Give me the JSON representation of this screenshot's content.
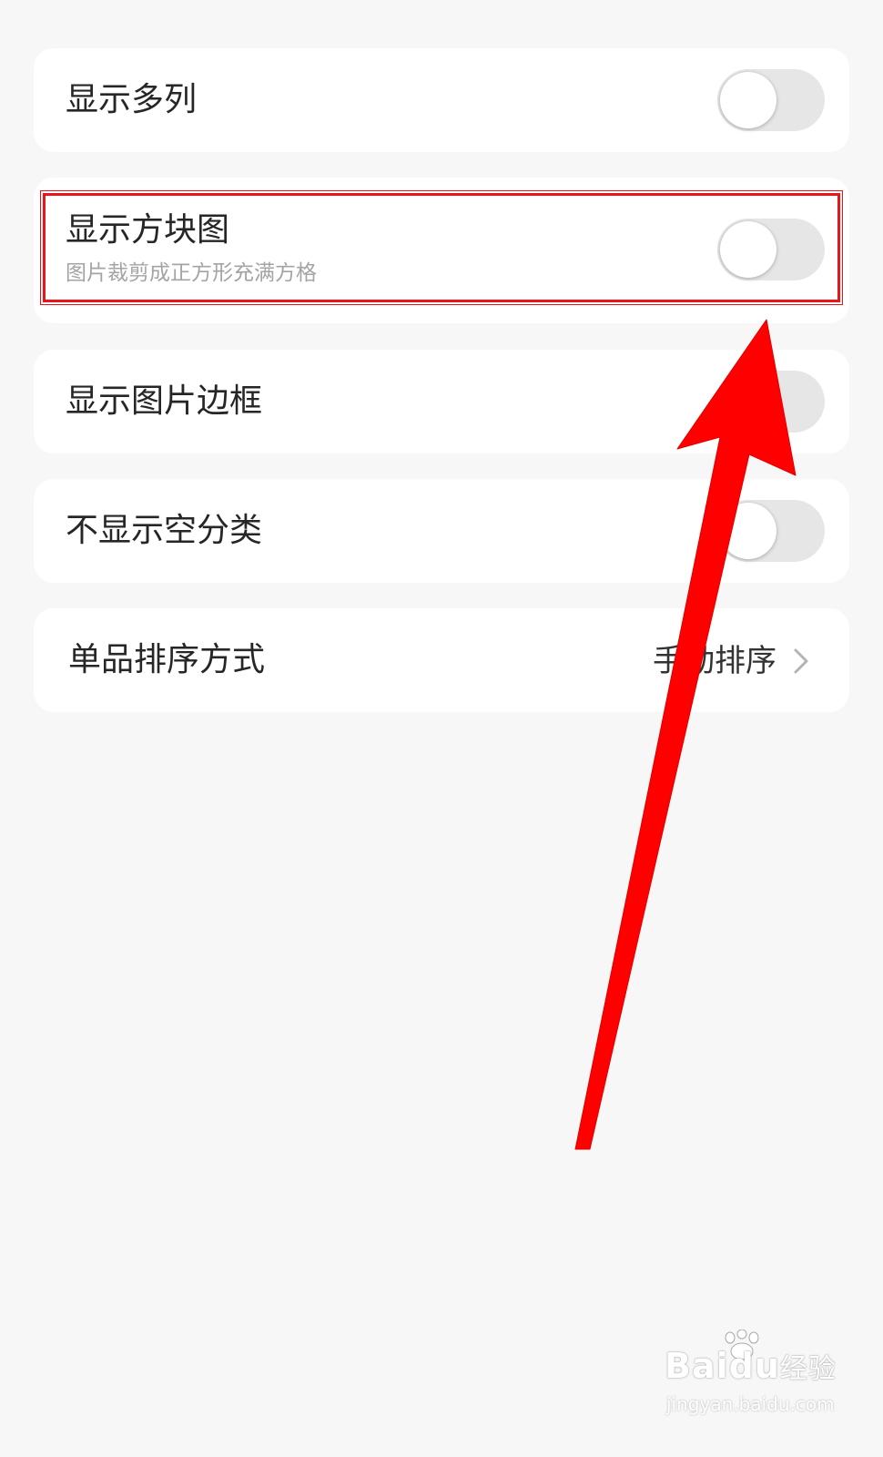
{
  "settings": {
    "items": [
      {
        "title": "显示多列",
        "subtitle": "",
        "control": "toggle",
        "on": false
      },
      {
        "title": "显示方块图",
        "subtitle": "图片裁剪成正方形充满方格",
        "control": "toggle",
        "on": false
      },
      {
        "title": "显示图片边框",
        "subtitle": "",
        "control": "toggle",
        "on": false
      },
      {
        "title": "不显示空分类",
        "subtitle": "",
        "control": "toggle",
        "on": false
      },
      {
        "title": "单品排序方式",
        "value": "手动排序",
        "control": "chevron"
      }
    ]
  },
  "annotation": {
    "highlight_color": "#e8161a",
    "arrow_color": "#ff0000",
    "target": "显示方块图"
  },
  "colors": {
    "background": "#f7f7f7",
    "card": "#ffffff",
    "toggle_off": "#e6e6e6",
    "subtitle": "#a4a4a4"
  },
  "watermark": {
    "brand": "Bai",
    "brand2": "du",
    "cn": "经验",
    "url": "jingyan.baidu.com"
  }
}
